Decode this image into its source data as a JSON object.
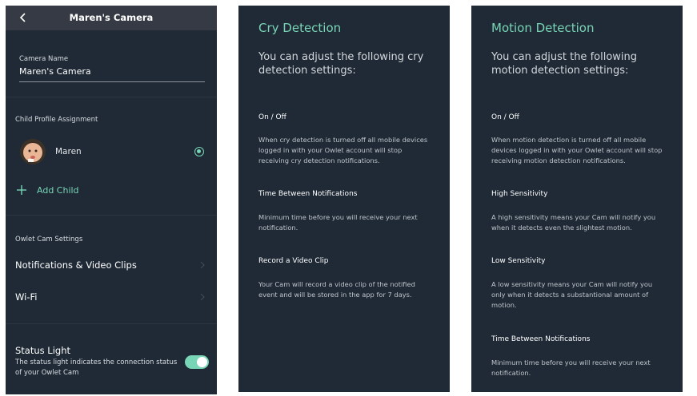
{
  "camera_screen": {
    "title": "Maren's Camera",
    "camera_name_label": "Camera Name",
    "camera_name_value": "Maren's Camera",
    "child_profile_section": "Child Profile Assignment",
    "child_name": "Maren",
    "child_selected": true,
    "add_child_label": "Add Child",
    "settings_section": "Owlet Cam Settings",
    "settings_items": [
      {
        "label": "Notifications & Video Clips"
      },
      {
        "label": "Wi-Fi"
      }
    ],
    "status_light_title": "Status Light",
    "status_light_description": "The status light indicates the connection status of your Owlet Cam",
    "status_light_on": true
  },
  "cry_detection": {
    "title": "Cry Detection",
    "intro": "You can adjust the following cry detection settings:",
    "items": [
      {
        "heading": "On / Off",
        "description": "When cry detection is turned off all mobile devices logged in with your Owlet account will stop receiving cry detection notifications."
      },
      {
        "heading": "Time Between Notifications",
        "description": "Minimum time before you will receive your next notification."
      },
      {
        "heading": "Record a Video Clip",
        "description": "Your Cam will record a video clip of the notified event and will be stored in the app for 7 days."
      }
    ]
  },
  "motion_detection": {
    "title": "Motion Detection",
    "intro": "You can adjust the following motion detection settings:",
    "items": [
      {
        "heading": "On / Off",
        "description": "When motion detection is turned off all mobile devices logged in with your Owlet account will stop receiving motion detection notifications."
      },
      {
        "heading": "High Sensitivity",
        "description": "A high sensitivity means your Cam will notify you when it detects even the slightest motion."
      },
      {
        "heading": "Low Sensitivity",
        "description": "A low sensitivity means your Cam will notify you only when it detects a substantional amount of motion."
      },
      {
        "heading": "Time Between Notifications",
        "description": "Minimum time before you will receive your next notification."
      }
    ]
  },
  "colors": {
    "panel_background": "#1f2a36",
    "top_bar": "#363a44",
    "accent_mint": "#78d5b5"
  },
  "icons": [
    "back-arrow-icon",
    "radio-selected-icon",
    "plus-icon",
    "chevron-right-icon",
    "toggle-switch"
  ]
}
